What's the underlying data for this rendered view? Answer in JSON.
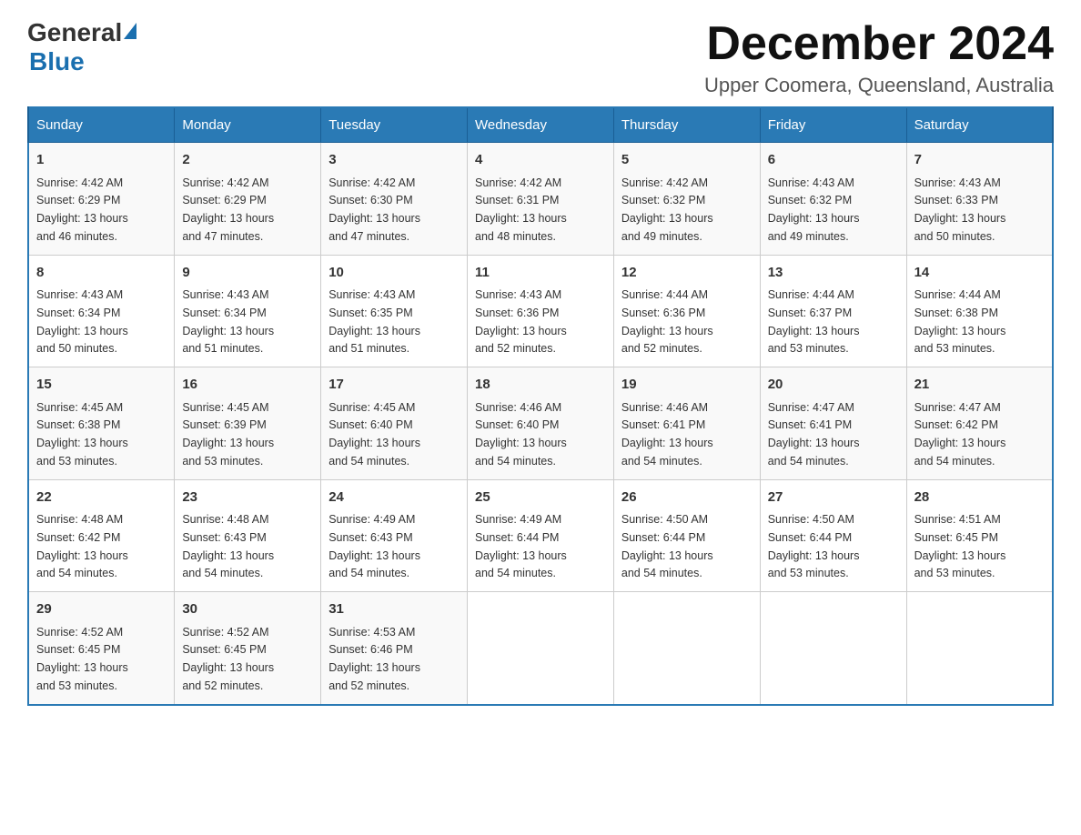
{
  "header": {
    "logo_general": "General",
    "logo_blue": "Blue",
    "month_title": "December 2024",
    "location": "Upper Coomera, Queensland, Australia"
  },
  "days_of_week": [
    "Sunday",
    "Monday",
    "Tuesday",
    "Wednesday",
    "Thursday",
    "Friday",
    "Saturday"
  ],
  "weeks": [
    [
      {
        "day": "1",
        "sunrise": "4:42 AM",
        "sunset": "6:29 PM",
        "daylight": "13 hours and 46 minutes."
      },
      {
        "day": "2",
        "sunrise": "4:42 AM",
        "sunset": "6:29 PM",
        "daylight": "13 hours and 47 minutes."
      },
      {
        "day": "3",
        "sunrise": "4:42 AM",
        "sunset": "6:30 PM",
        "daylight": "13 hours and 47 minutes."
      },
      {
        "day": "4",
        "sunrise": "4:42 AM",
        "sunset": "6:31 PM",
        "daylight": "13 hours and 48 minutes."
      },
      {
        "day": "5",
        "sunrise": "4:42 AM",
        "sunset": "6:32 PM",
        "daylight": "13 hours and 49 minutes."
      },
      {
        "day": "6",
        "sunrise": "4:43 AM",
        "sunset": "6:32 PM",
        "daylight": "13 hours and 49 minutes."
      },
      {
        "day": "7",
        "sunrise": "4:43 AM",
        "sunset": "6:33 PM",
        "daylight": "13 hours and 50 minutes."
      }
    ],
    [
      {
        "day": "8",
        "sunrise": "4:43 AM",
        "sunset": "6:34 PM",
        "daylight": "13 hours and 50 minutes."
      },
      {
        "day": "9",
        "sunrise": "4:43 AM",
        "sunset": "6:34 PM",
        "daylight": "13 hours and 51 minutes."
      },
      {
        "day": "10",
        "sunrise": "4:43 AM",
        "sunset": "6:35 PM",
        "daylight": "13 hours and 51 minutes."
      },
      {
        "day": "11",
        "sunrise": "4:43 AM",
        "sunset": "6:36 PM",
        "daylight": "13 hours and 52 minutes."
      },
      {
        "day": "12",
        "sunrise": "4:44 AM",
        "sunset": "6:36 PM",
        "daylight": "13 hours and 52 minutes."
      },
      {
        "day": "13",
        "sunrise": "4:44 AM",
        "sunset": "6:37 PM",
        "daylight": "13 hours and 53 minutes."
      },
      {
        "day": "14",
        "sunrise": "4:44 AM",
        "sunset": "6:38 PM",
        "daylight": "13 hours and 53 minutes."
      }
    ],
    [
      {
        "day": "15",
        "sunrise": "4:45 AM",
        "sunset": "6:38 PM",
        "daylight": "13 hours and 53 minutes."
      },
      {
        "day": "16",
        "sunrise": "4:45 AM",
        "sunset": "6:39 PM",
        "daylight": "13 hours and 53 minutes."
      },
      {
        "day": "17",
        "sunrise": "4:45 AM",
        "sunset": "6:40 PM",
        "daylight": "13 hours and 54 minutes."
      },
      {
        "day": "18",
        "sunrise": "4:46 AM",
        "sunset": "6:40 PM",
        "daylight": "13 hours and 54 minutes."
      },
      {
        "day": "19",
        "sunrise": "4:46 AM",
        "sunset": "6:41 PM",
        "daylight": "13 hours and 54 minutes."
      },
      {
        "day": "20",
        "sunrise": "4:47 AM",
        "sunset": "6:41 PM",
        "daylight": "13 hours and 54 minutes."
      },
      {
        "day": "21",
        "sunrise": "4:47 AM",
        "sunset": "6:42 PM",
        "daylight": "13 hours and 54 minutes."
      }
    ],
    [
      {
        "day": "22",
        "sunrise": "4:48 AM",
        "sunset": "6:42 PM",
        "daylight": "13 hours and 54 minutes."
      },
      {
        "day": "23",
        "sunrise": "4:48 AM",
        "sunset": "6:43 PM",
        "daylight": "13 hours and 54 minutes."
      },
      {
        "day": "24",
        "sunrise": "4:49 AM",
        "sunset": "6:43 PM",
        "daylight": "13 hours and 54 minutes."
      },
      {
        "day": "25",
        "sunrise": "4:49 AM",
        "sunset": "6:44 PM",
        "daylight": "13 hours and 54 minutes."
      },
      {
        "day": "26",
        "sunrise": "4:50 AM",
        "sunset": "6:44 PM",
        "daylight": "13 hours and 54 minutes."
      },
      {
        "day": "27",
        "sunrise": "4:50 AM",
        "sunset": "6:44 PM",
        "daylight": "13 hours and 53 minutes."
      },
      {
        "day": "28",
        "sunrise": "4:51 AM",
        "sunset": "6:45 PM",
        "daylight": "13 hours and 53 minutes."
      }
    ],
    [
      {
        "day": "29",
        "sunrise": "4:52 AM",
        "sunset": "6:45 PM",
        "daylight": "13 hours and 53 minutes."
      },
      {
        "day": "30",
        "sunrise": "4:52 AM",
        "sunset": "6:45 PM",
        "daylight": "13 hours and 52 minutes."
      },
      {
        "day": "31",
        "sunrise": "4:53 AM",
        "sunset": "6:46 PM",
        "daylight": "13 hours and 52 minutes."
      },
      null,
      null,
      null,
      null
    ]
  ],
  "labels": {
    "sunrise": "Sunrise:",
    "sunset": "Sunset:",
    "daylight": "Daylight:"
  }
}
